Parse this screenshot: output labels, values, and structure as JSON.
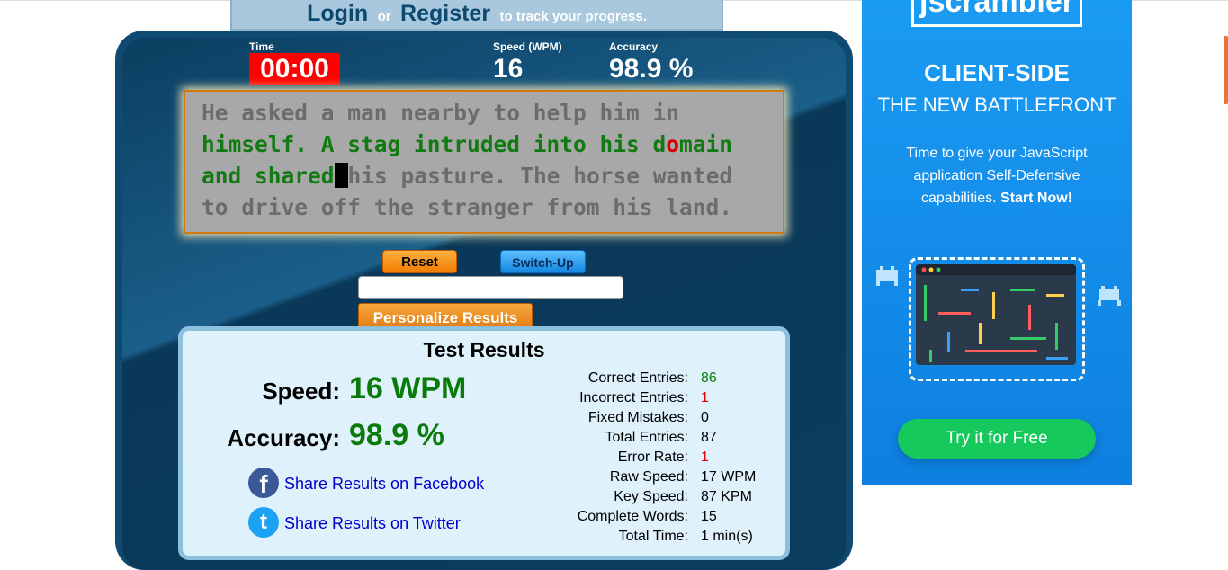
{
  "login_bar": {
    "login": "Login",
    "or": "or",
    "register": "Register",
    "suffix": "to track your progress."
  },
  "stats": {
    "time_label": "Time",
    "time_value": "00:00",
    "speed_label": "Speed (WPM)",
    "speed_value": "16",
    "accuracy_label": "Accuracy",
    "accuracy_value": "98.9 %"
  },
  "passage": {
    "line1_untyped": "He asked a man nearby to help him in",
    "line2_typed_a": "himself. A stag intruded into his d",
    "line2_error": "o",
    "line2_typed_b": "main",
    "line3_typed": "and shared",
    "line3_cursor_char": " ",
    "line3_untyped": "his pasture. The horse wanted",
    "line4_untyped": "to drive off the stranger from his land."
  },
  "controls": {
    "reset": "Reset",
    "switch_up": "Switch-Up",
    "input_value": "",
    "personalize": "Personalize Results"
  },
  "results": {
    "title": "Test Results",
    "speed_label": "Speed:",
    "speed_value": "16 WPM",
    "accuracy_label": "Accuracy:",
    "accuracy_value": "98.9 %",
    "share_facebook": "Share Results on Facebook",
    "share_twitter": "Share Results on Twitter",
    "rows": [
      {
        "label": "Correct Entries:",
        "value": "86",
        "tone": "green"
      },
      {
        "label": "Incorrect Entries:",
        "value": "1",
        "tone": "red"
      },
      {
        "label": "Fixed Mistakes:",
        "value": "0",
        "tone": "plain"
      },
      {
        "label": "Total Entries:",
        "value": "87",
        "tone": "plain"
      },
      {
        "label": "Error Rate:",
        "value": "1",
        "tone": "red"
      },
      {
        "label": "Raw Speed:",
        "value": "17 WPM",
        "tone": "plain"
      },
      {
        "label": "Key Speed:",
        "value": "87 KPM",
        "tone": "plain"
      },
      {
        "label": "Complete Words:",
        "value": "15",
        "tone": "plain"
      },
      {
        "label": "Total Time:",
        "value": "1 min(s)",
        "tone": "plain"
      }
    ]
  },
  "ad": {
    "logo": "jscrambler",
    "headline": "CLIENT-SIDE",
    "subheadline": "THE NEW BATTLEFRONT",
    "body": "Time to give your JavaScript application Self-Defensive capabilities.",
    "body_bold": "Start Now!",
    "cta": "Try it for Free"
  },
  "colors": {
    "panel": "#0e4a72",
    "timer_bg": "#ff0000",
    "typed_text": "#127a12",
    "error_text": "#d40000",
    "ad_bg": "#1a9bf3",
    "cta_bg": "#16c95c"
  },
  "icons": [
    "facebook-icon",
    "twitter-icon",
    "cursor-block"
  ]
}
